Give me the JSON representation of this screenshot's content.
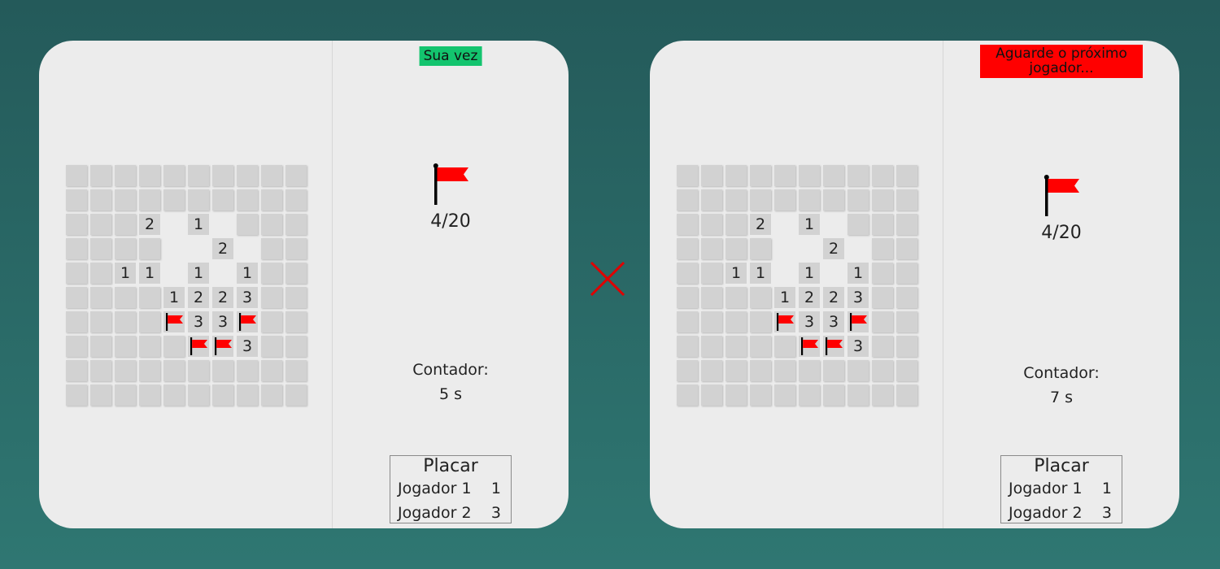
{
  "boards": [
    {
      "status": "Sua vez",
      "flags": "4/20",
      "counter_label": "Contador:",
      "counter_value": "5 s",
      "score_title": "Placar",
      "scores": [
        {
          "name": "Jogador 1",
          "value": "1"
        },
        {
          "name": "Jogador 2",
          "value": "3"
        }
      ]
    },
    {
      "status": "Aguarde o próximo jogador...",
      "flags": "4/20",
      "counter_label": "Contador:",
      "counter_value": "7 s",
      "score_title": "Placar",
      "scores": [
        {
          "name": "Jogador 1",
          "value": "1"
        },
        {
          "name": "Jogador 2",
          "value": "3"
        }
      ]
    }
  ],
  "grid": [
    "..........",
    "..........",
    "...2o1o...",
    "....oo2o..",
    "..11o1o1..",
    "....1223..",
    "....F33F..",
    ".....FF3..",
    "..........",
    ".........."
  ],
  "grid_legend": {
    ".": "hidden",
    "o": "revealed-empty",
    "F": "flagged",
    "digit": "revealed-number"
  },
  "colors": {
    "background_top": "#245a5a",
    "background_bottom": "#2f7772",
    "panel": "#ececec",
    "cell_hidden": "#d2d2d2",
    "status_your_turn": "#13c46e",
    "status_wait": "#ff0000",
    "flag": "#ff0000",
    "divider_x": "#e00000"
  },
  "icons": {
    "flag": "flag-icon",
    "separator": "close-icon"
  }
}
